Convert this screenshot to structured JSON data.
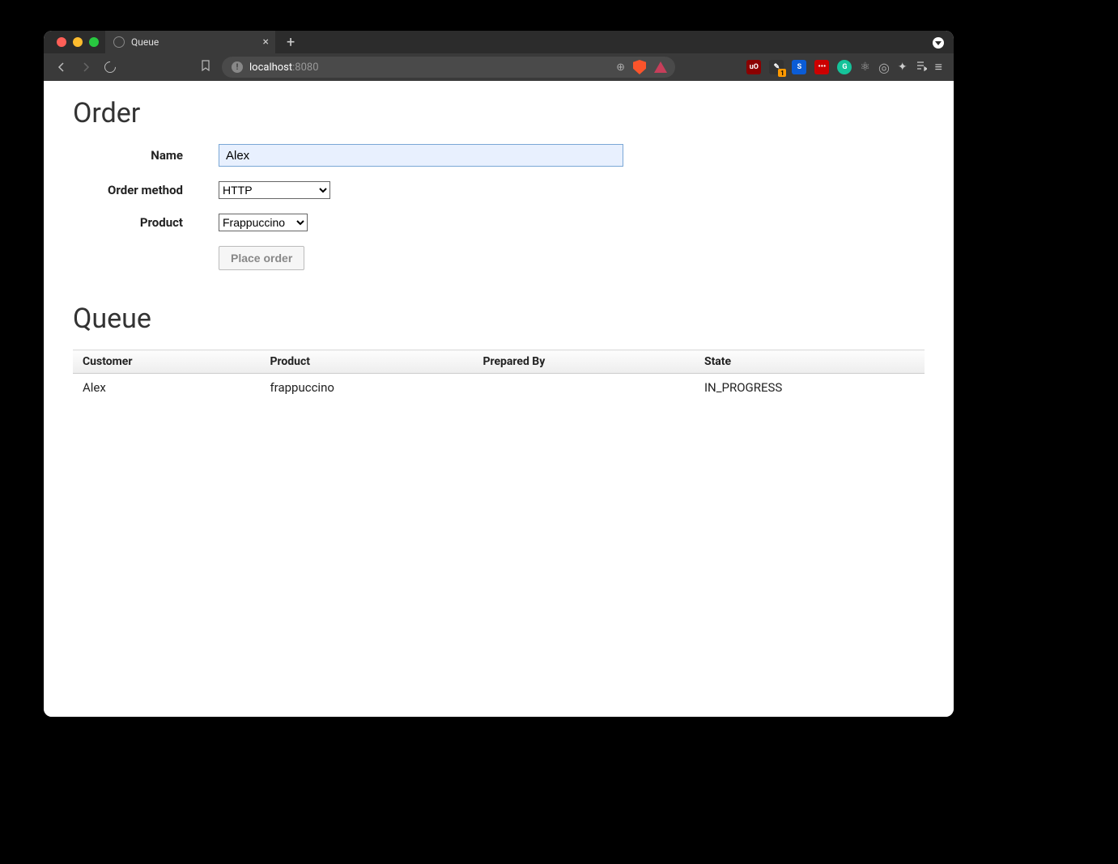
{
  "browser": {
    "tab_title": "Queue",
    "url_host": "localhost",
    "url_port": ":8080"
  },
  "page": {
    "order_heading": "Order",
    "queue_heading": "Queue",
    "form": {
      "name_label": "Name",
      "name_value": "Alex",
      "method_label": "Order method",
      "method_value": "HTTP",
      "product_label": "Product",
      "product_value": "Frappuccino",
      "submit_label": "Place order"
    },
    "queue": {
      "columns": {
        "customer": "Customer",
        "product": "Product",
        "prepared_by": "Prepared By",
        "state": "State"
      },
      "rows": [
        {
          "customer": "Alex",
          "product": "frappuccino",
          "prepared_by": "",
          "state": "IN_PROGRESS"
        }
      ]
    }
  }
}
